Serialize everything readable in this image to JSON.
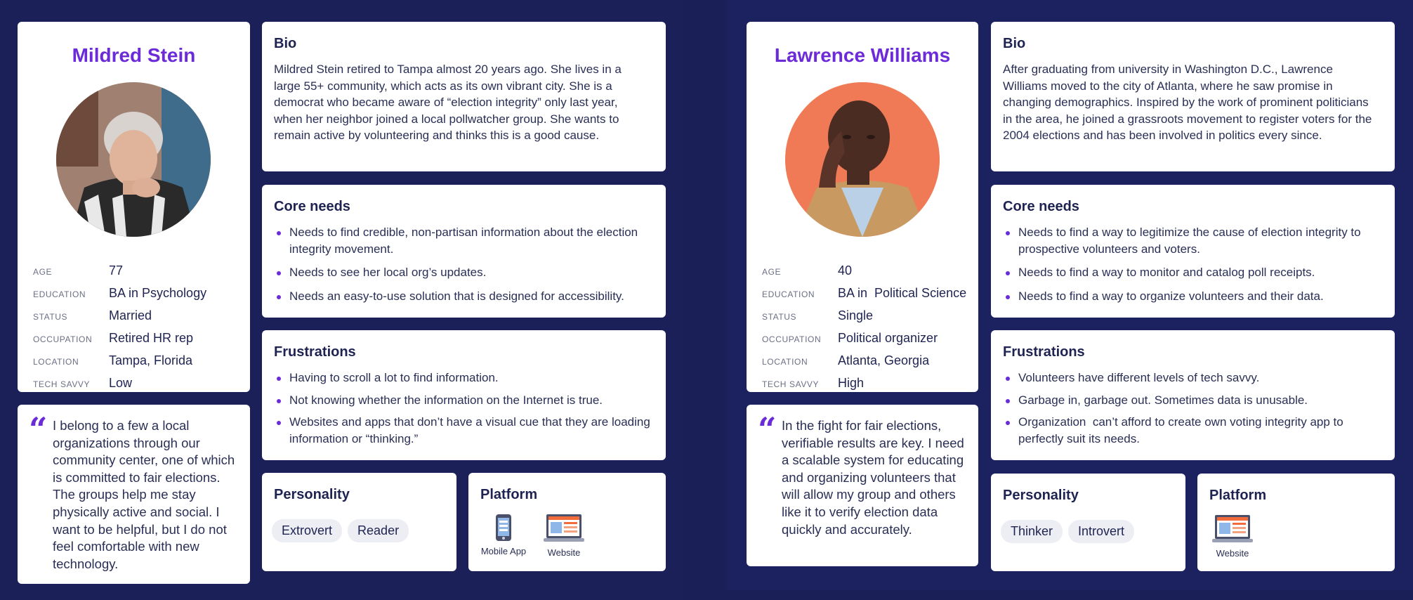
{
  "personas": [
    {
      "name": "Mildred Stein",
      "facts": [
        {
          "label": "AGE",
          "value": "77"
        },
        {
          "label": "EDUCATION",
          "value": "BA in Psychology"
        },
        {
          "label": "STATUS",
          "value": "Married"
        },
        {
          "label": "OCCUPATION",
          "value": "Retired HR rep"
        },
        {
          "label": "LOCATION",
          "value": "Tampa, Florida"
        },
        {
          "label": "TECH SAVVY",
          "value": "Low"
        }
      ],
      "quote": "I belong to a few a local organizations through our community center, one of which is committed to fair elections. The groups help me stay physically active and social. I want to be helpful, but I do not feel comfortable with new technology.",
      "bio_title": "Bio",
      "bio": "Mildred Stein retired to Tampa almost 20 years ago. She lives in a large 55+ community, which acts as its own vibrant city. She is a democrat who became aware of “election integrity” only last year, when her neighbor joined a local pollwatcher group. She wants to remain active by volunteering and thinks this is a good cause.",
      "needs_title": "Core needs",
      "needs": [
        "Needs to find credible, non-partisan information about the election integrity movement.",
        "Needs to see her local org’s updates.",
        "Needs an easy-to-use solution that is designed for accessibility."
      ],
      "frustrations_title": "Frustrations",
      "frustrations": [
        "Having to scroll a lot to find information.",
        "Not knowing whether the information on the Internet is true.",
        "Websites and apps that don’t have a visual cue that they are loading information or “thinking.”"
      ],
      "personality_title": "Personality",
      "personality": [
        "Extrovert",
        "Reader"
      ],
      "platform_title": "Platform",
      "platforms": [
        "Mobile App",
        "Website"
      ]
    },
    {
      "name": "Lawrence Williams",
      "facts": [
        {
          "label": "AGE",
          "value": "40"
        },
        {
          "label": "EDUCATION",
          "value": "BA in  Political Science"
        },
        {
          "label": "STATUS",
          "value": "Single"
        },
        {
          "label": "OCCUPATION",
          "value": "Political organizer"
        },
        {
          "label": "LOCATION",
          "value": "Atlanta, Georgia"
        },
        {
          "label": "TECH SAVVY",
          "value": "High"
        }
      ],
      "quote": "In the fight for fair elections, verifiable results are key. I need a scalable system for educating and organizing volunteers that will allow my group and others like it to verify election data quickly and accurately.",
      "bio_title": "Bio",
      "bio": "After graduating from university in Washington D.C., Lawrence Williams moved to the city of Atlanta, where he saw promise in changing demographics. Inspired by the work of prominent politicians in the area, he joined a grassroots movement to register voters for the 2004 elections and has been involved in politics every since.",
      "needs_title": "Core needs",
      "needs": [
        "Needs to find a way to legitimize the cause of election integrity to prospective volunteers and voters.",
        "Needs to find a way to monitor and catalog poll receipts.",
        "Needs to find a way to organize volunteers and their data."
      ],
      "frustrations_title": "Frustrations",
      "frustrations": [
        "Volunteers have different levels of tech savvy.",
        "Garbage in, garbage out. Sometimes data is unusable.",
        "Organization  can’t afford to create own voting integrity app to perfectly suit its needs."
      ],
      "personality_title": "Personality",
      "personality": [
        "Thinker",
        "Introvert"
      ],
      "platform_title": "Platform",
      "platforms": [
        "Website"
      ]
    }
  ],
  "colors": {
    "background": "#1a1f57",
    "accent": "#6b2bd9",
    "card": "#ffffff",
    "text": "#1e2352",
    "tag": "#eceef3"
  },
  "icons": [
    "quote-icon",
    "mobile-phone-icon",
    "laptop-icon",
    "avatar-photo"
  ]
}
